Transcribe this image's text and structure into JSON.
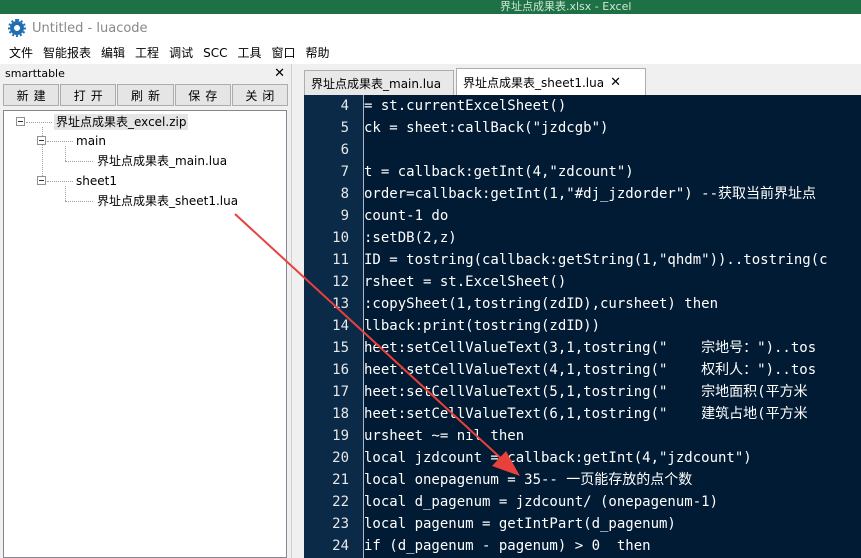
{
  "background_window": {
    "title": "界址点成果表.xlsx  -  Excel"
  },
  "app": {
    "title": "Untitled - luacode"
  },
  "menu": [
    "文件",
    "智能报表",
    "编辑",
    "工程",
    "调试",
    "SCC",
    "工具",
    "窗口",
    "帮助"
  ],
  "panel": {
    "title": "smarttable",
    "close_glyph": "✕",
    "buttons": [
      "新建",
      "打开",
      "刷新",
      "保存",
      "关闭"
    ]
  },
  "tree": {
    "root": "界址点成果表_excel.zip",
    "main": "main",
    "main_file": "界址点成果表_main.lua",
    "sheet": "sheet1",
    "sheet_file": "界址点成果表_sheet1.lua"
  },
  "tabs": [
    {
      "label": "界址点成果表_main.lua"
    },
    {
      "label": "界址点成果表_sheet1.lua",
      "close_glyph": "✕"
    }
  ],
  "code": [
    {
      "n": "4",
      "text": "= st.currentExcelSheet()"
    },
    {
      "n": "5",
      "text": "ck = sheet:callBack(\"jzdcgb\")"
    },
    {
      "n": "6",
      "text": ""
    },
    {
      "n": "7",
      "text": "t = callback:getInt(4,\"zdcount\")"
    },
    {
      "n": "8",
      "text": "order=callback:getInt(1,\"#dj_jzdorder\") --获取当前界址点"
    },
    {
      "n": "9",
      "text": "count-1 do"
    },
    {
      "n": "10",
      "text": ":setDB(2,z)"
    },
    {
      "n": "11",
      "text": "ID = tostring(callback:getString(1,\"qhdm\"))..tostring(c"
    },
    {
      "n": "12",
      "text": "rsheet = st.ExcelSheet()"
    },
    {
      "n": "13",
      "text": ":copySheet(1,tostring(zdID),cursheet) then"
    },
    {
      "n": "14",
      "text": "llback:print(tostring(zdID))"
    },
    {
      "n": "15",
      "text": "heet:setCellValueText(3,1,tostring(\"    宗地号：\")..tos"
    },
    {
      "n": "16",
      "text": "heet:setCellValueText(4,1,tostring(\"    权利人：\")..tos"
    },
    {
      "n": "17",
      "text": "heet:setCellValueText(5,1,tostring(\"    宗地面积(平方米"
    },
    {
      "n": "18",
      "text": "heet:setCellValueText(6,1,tostring(\"    建筑占地(平方米"
    },
    {
      "n": "19",
      "text": "ursheet ~= nil then"
    },
    {
      "n": "20",
      "text": "local jzdcount = callback:getInt(4,\"jzdcount\")"
    },
    {
      "n": "21",
      "text": "local onepagenum = 35-- 一页能存放的点个数"
    },
    {
      "n": "22",
      "text": "local d_pagenum = jzdcount/ (onepagenum-1)"
    },
    {
      "n": "23",
      "text": "local pagenum = getIntPart(d_pagenum)"
    },
    {
      "n": "24",
      "text": "if (d_pagenum - pagenum) > 0  then"
    }
  ],
  "colors": {
    "editor_bg": "#001b33",
    "gutter_bg": "#0b2a47",
    "arrow": "#e8413c",
    "excel_green": "#1e7145"
  }
}
